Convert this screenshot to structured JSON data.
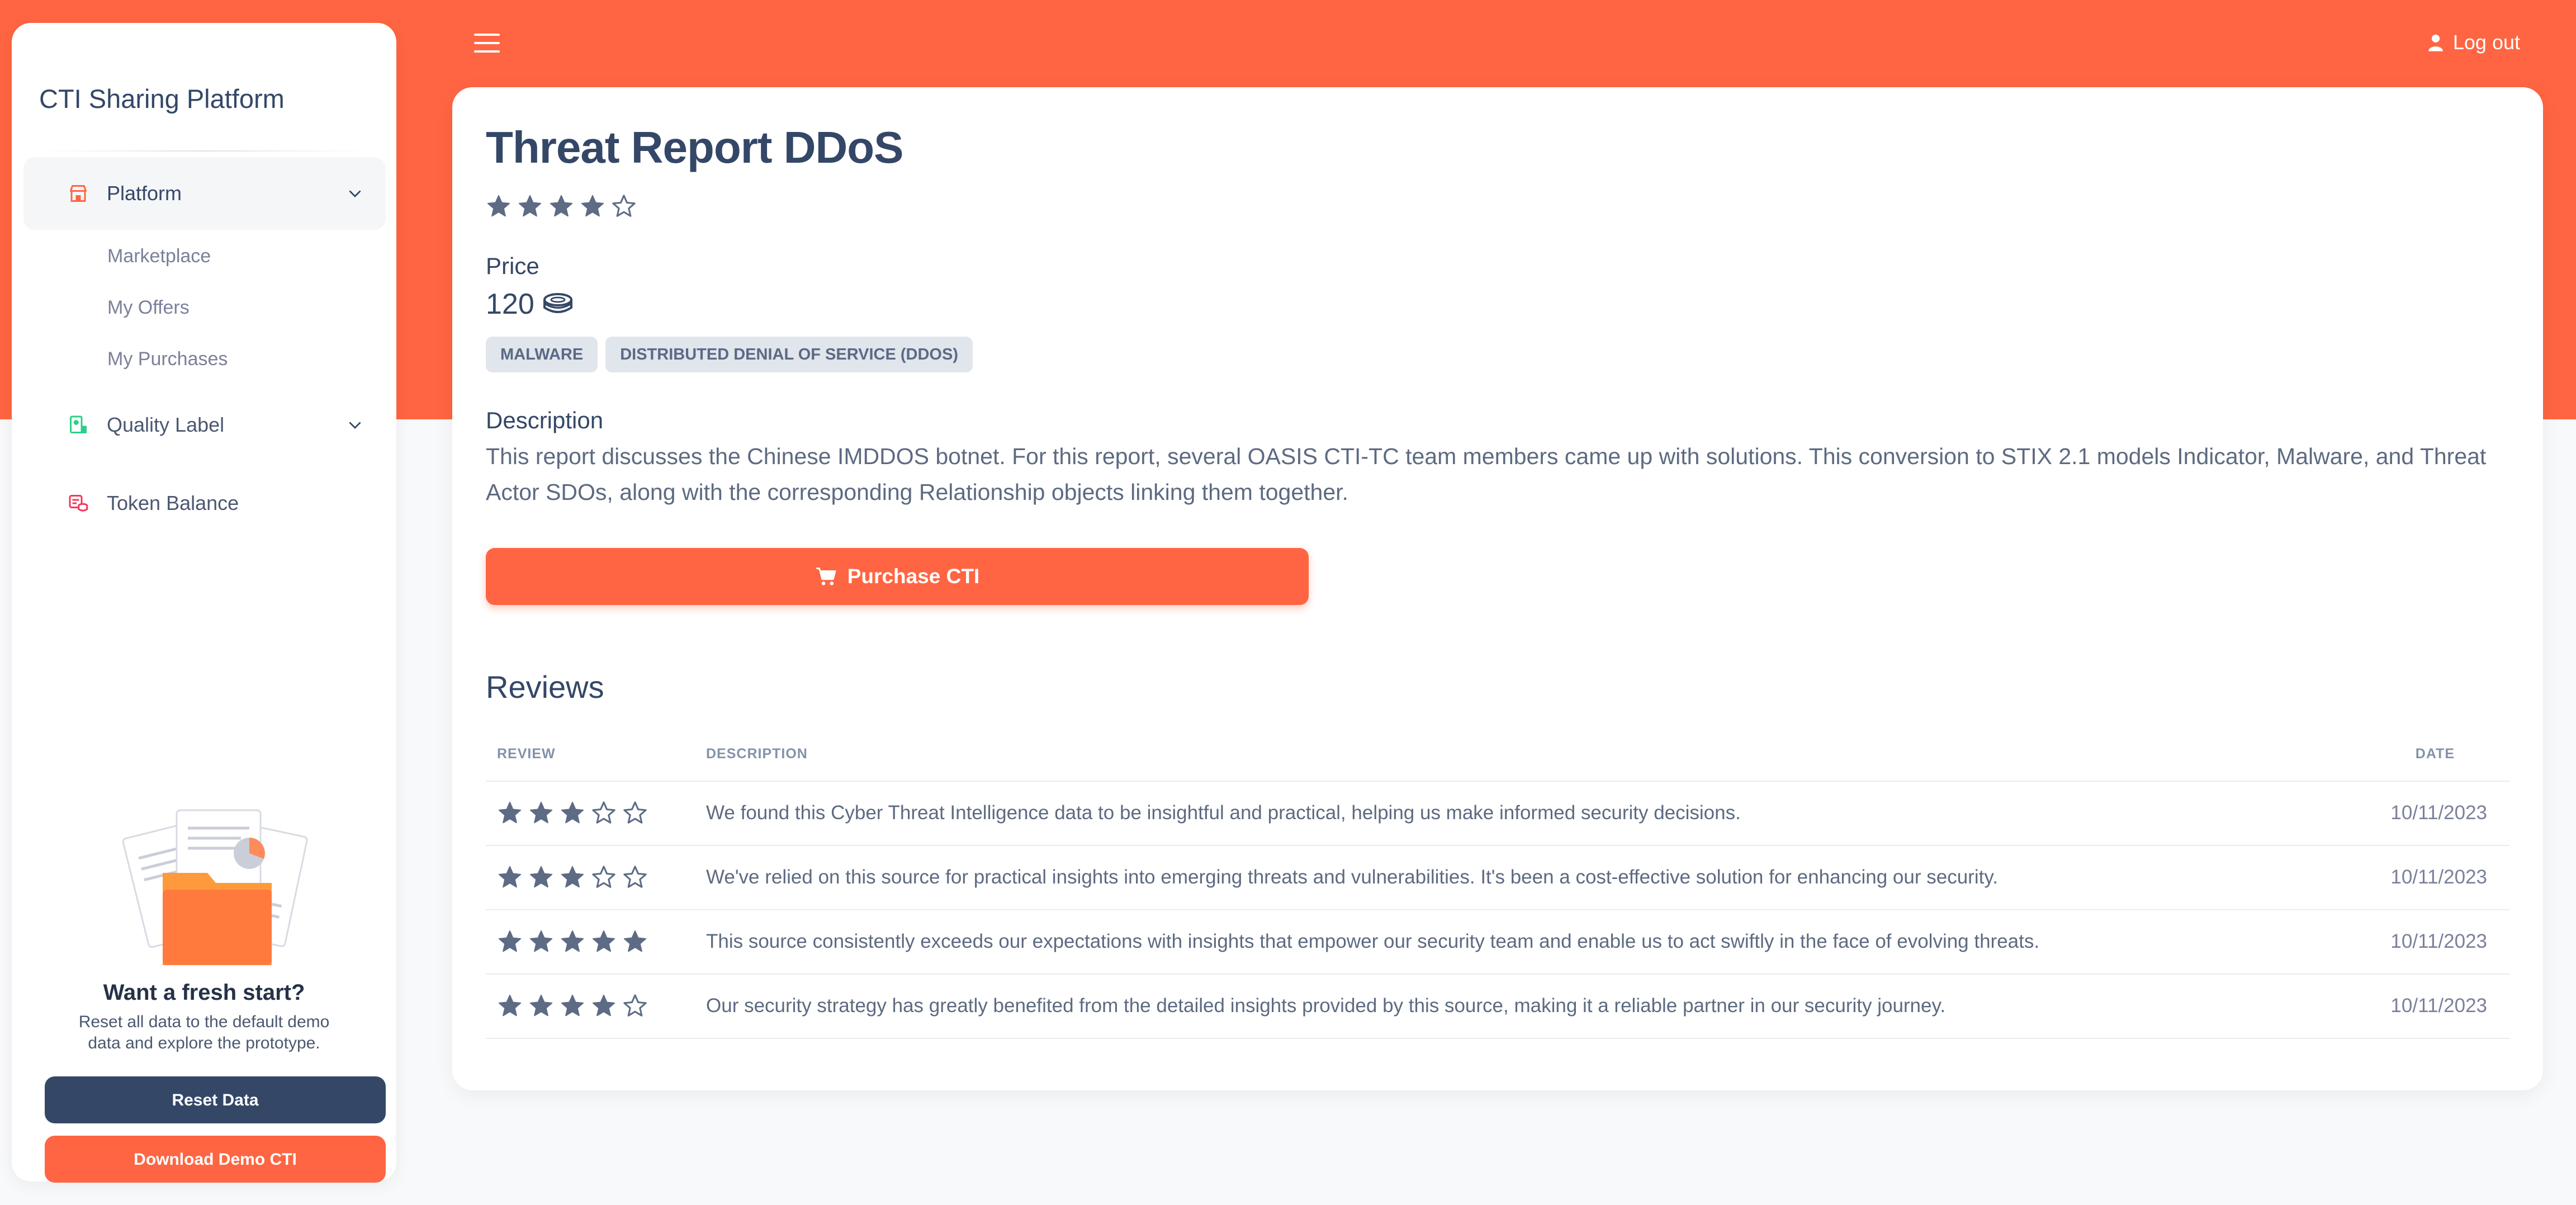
{
  "app": {
    "title": "CTI Sharing Platform"
  },
  "sidebar": {
    "platform": {
      "label": "Platform",
      "icon": "shop-icon"
    },
    "sub_items": [
      "Marketplace",
      "My Offers",
      "My Purchases"
    ],
    "quality_label": {
      "label": "Quality Label",
      "icon": "badge-icon"
    },
    "token_balance": {
      "label": "Token Balance",
      "icon": "coins-icon"
    },
    "fresh_start": {
      "title": "Want a fresh start?",
      "text": "Reset all data to the default demo data and explore the prototype.",
      "reset_label": "Reset Data",
      "download_label": "Download Demo CTI"
    }
  },
  "topbar": {
    "logout_label": "Log out"
  },
  "report": {
    "title": "Threat Report DDoS",
    "rating": 4,
    "price_label": "Price",
    "price": "120",
    "tags": [
      "MALWARE",
      "DISTRIBUTED DENIAL OF SERVICE (DDOS)"
    ],
    "description_label": "Description",
    "description": "This report discusses the Chinese IMDDOS botnet. For this report, several OASIS CTI-TC team members came up with solutions. This conversion to STIX 2.1 models Indicator, Malware, and Threat Actor SDOs, along with the corresponding Relationship objects linking them together.",
    "purchase_label": "Purchase CTI"
  },
  "reviews": {
    "title": "Reviews",
    "columns": [
      "REVIEW",
      "DESCRIPTION",
      "DATE"
    ],
    "rows": [
      {
        "rating": 3,
        "description": "We found this Cyber Threat Intelligence data to be insightful and practical, helping us make informed security decisions.",
        "date": "10/11/2023"
      },
      {
        "rating": 3,
        "description": "We've relied on this source for practical insights into emerging threats and vulnerabilities. It's been a cost-effective solution for enhancing our security.",
        "date": "10/11/2023"
      },
      {
        "rating": 5,
        "description": "This source consistently exceeds our expectations with insights that empower our security team and enable us to act swiftly in the face of evolving threats.",
        "date": "10/11/2023"
      },
      {
        "rating": 4,
        "description": "Our security strategy has greatly benefited from the detailed insights provided by this source, making it a reliable partner in our security journey.",
        "date": "10/11/2023"
      }
    ]
  },
  "colors": {
    "accent": "#ff6542",
    "dark": "#344767",
    "star": "#5d6b85"
  }
}
